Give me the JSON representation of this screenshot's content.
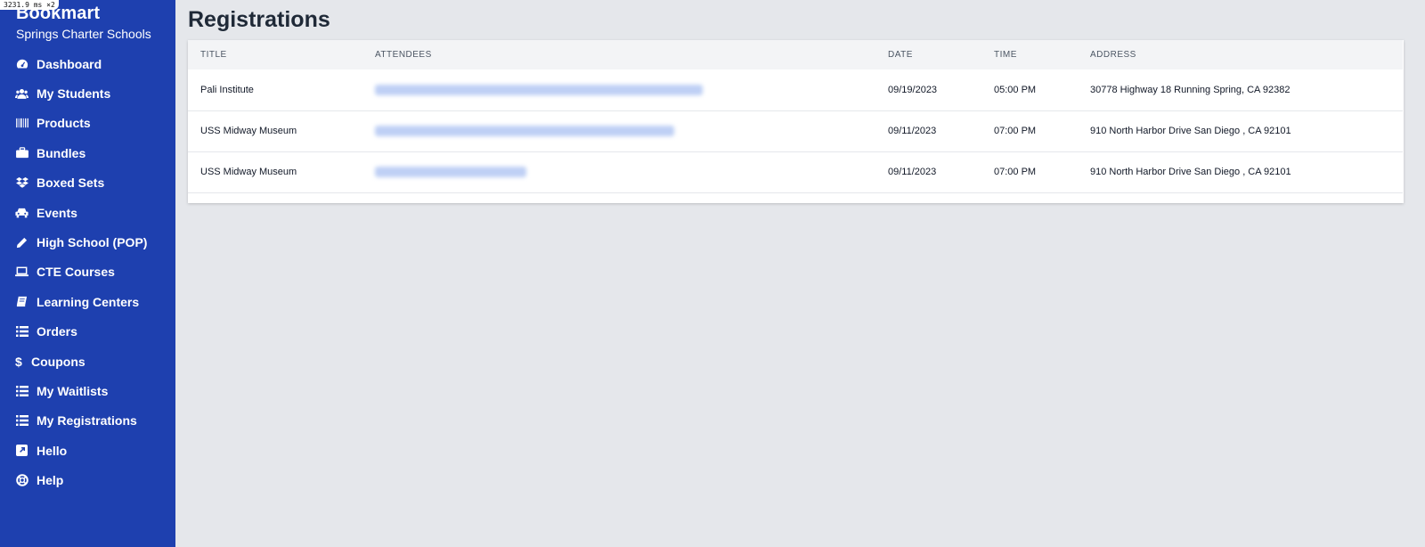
{
  "overlay": {
    "timing": "3231.9 ms ×2"
  },
  "sidebar": {
    "brand": "Bookmart",
    "school": "Springs Charter Schools",
    "items": [
      {
        "label": "Dashboard",
        "icon": "dashboard-icon"
      },
      {
        "label": "My Students",
        "icon": "users-icon"
      },
      {
        "label": "Products",
        "icon": "barcode-icon"
      },
      {
        "label": "Bundles",
        "icon": "briefcase-icon"
      },
      {
        "label": "Boxed Sets",
        "icon": "dropbox-icon"
      },
      {
        "label": "Events",
        "icon": "car-icon"
      },
      {
        "label": "High School (POP)",
        "icon": "pencil-icon"
      },
      {
        "label": "CTE Courses",
        "icon": "laptop-icon"
      },
      {
        "label": "Learning Centers",
        "icon": "book-icon"
      },
      {
        "label": "Orders",
        "icon": "list-icon"
      },
      {
        "label": "Coupons",
        "icon": "dollar-icon"
      },
      {
        "label": "My Waitlists",
        "icon": "list-icon"
      },
      {
        "label": "My Registrations",
        "icon": "list-icon"
      },
      {
        "label": "Hello",
        "icon": "external-link-icon"
      },
      {
        "label": "Help",
        "icon": "lifebuoy-icon"
      }
    ]
  },
  "main": {
    "title": "Registrations",
    "table": {
      "headers": {
        "title": "TITLE",
        "attendees": "ATTENDEES",
        "date": "DATE",
        "time": "TIME",
        "address": "ADDRESS"
      },
      "rows": [
        {
          "title": "Pali Institute",
          "date": "09/19/2023",
          "time": "05:00 PM",
          "address": "30778 Highway 18 Running Spring, CA 92382"
        },
        {
          "title": "USS Midway Museum",
          "date": "09/11/2023",
          "time": "07:00 PM",
          "address": "910 North Harbor Drive San Diego , CA 92101"
        },
        {
          "title": "USS Midway Museum",
          "date": "09/11/2023",
          "time": "07:00 PM",
          "address": "910 North Harbor Drive San Diego , CA 92101"
        }
      ]
    }
  }
}
